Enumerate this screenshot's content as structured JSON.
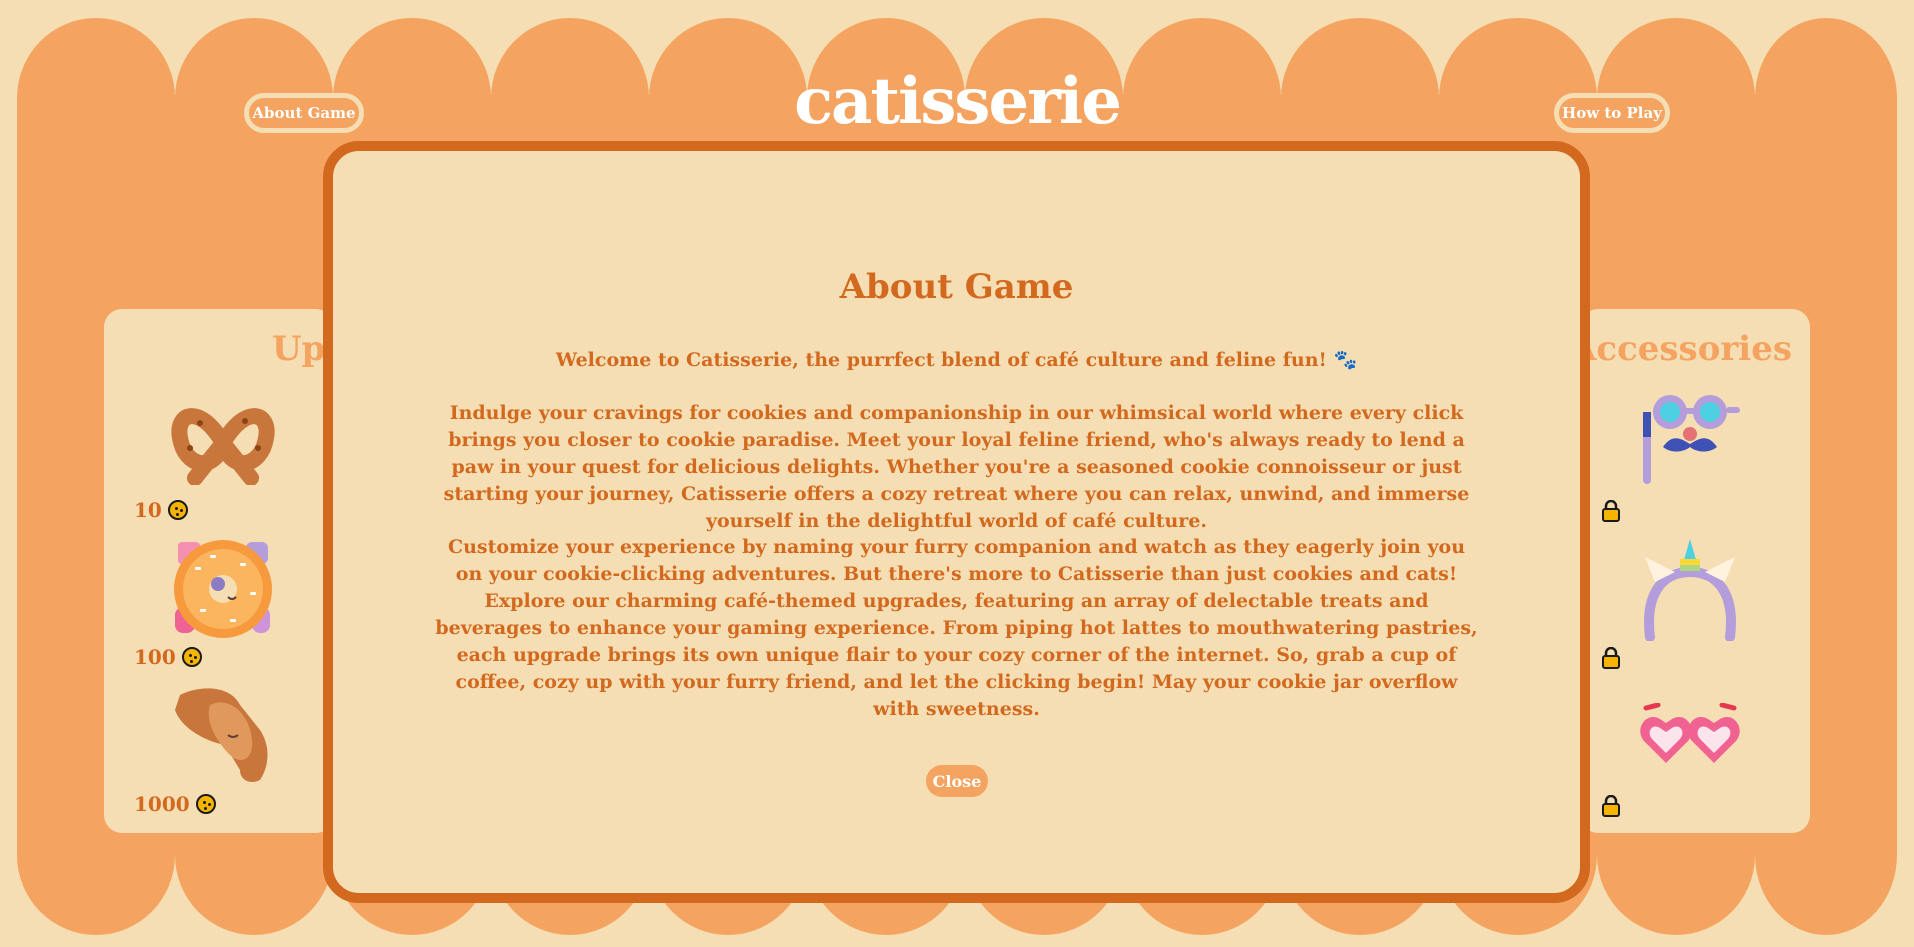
{
  "header": {
    "title": "catisserie",
    "about_button": "About Game",
    "howto_button": "How to Play"
  },
  "upgrades_panel": {
    "heading": "Upgrades",
    "items": [
      {
        "icon": "pretzel-icon",
        "price": "10"
      },
      {
        "icon": "donut-icon",
        "price": "100"
      },
      {
        "icon": "croissant-icon",
        "price": "1000"
      }
    ]
  },
  "accessories_panel": {
    "heading": "Accessories",
    "items": [
      {
        "icon": "party-glasses-icon",
        "locked": true
      },
      {
        "icon": "unicorn-headband-icon",
        "locked": true
      },
      {
        "icon": "heart-glasses-icon",
        "locked": true
      }
    ]
  },
  "modal": {
    "title": "About Game",
    "paragraph1": "Welcome to Catisserie, the purrfect blend of café culture and feline fun! 🐾",
    "paragraph2": "Indulge your cravings for cookies and companionship in our whimsical world where every click brings you closer to cookie paradise. Meet your loyal feline friend, who's always ready to lend a paw in your quest for delicious delights. Whether you're a seasoned cookie connoisseur or just starting your journey, Catisserie offers a cozy retreat where you can relax, unwind, and immerse yourself in the delightful world of café culture.",
    "paragraph3": "Customize your experience by naming your furry companion and watch as they eagerly join you on your cookie-clicking adventures. But there's more to Catisserie than just cookies and cats! Explore our charming café-themed upgrades, featuring an array of delectable treats and beverages to enhance your gaming experience. From piping hot lattes to mouthwatering pastries, each upgrade brings its own unique flair to your cozy corner of the internet. So, grab a cup of coffee, cozy up with your furry friend, and let the clicking begin! May your cookie jar overflow with sweetness.",
    "close_button": "Close"
  },
  "colors": {
    "background": "#f5deb3",
    "frame": "#f4a460",
    "accent": "#d2691e",
    "text_light": "#ffffff"
  }
}
